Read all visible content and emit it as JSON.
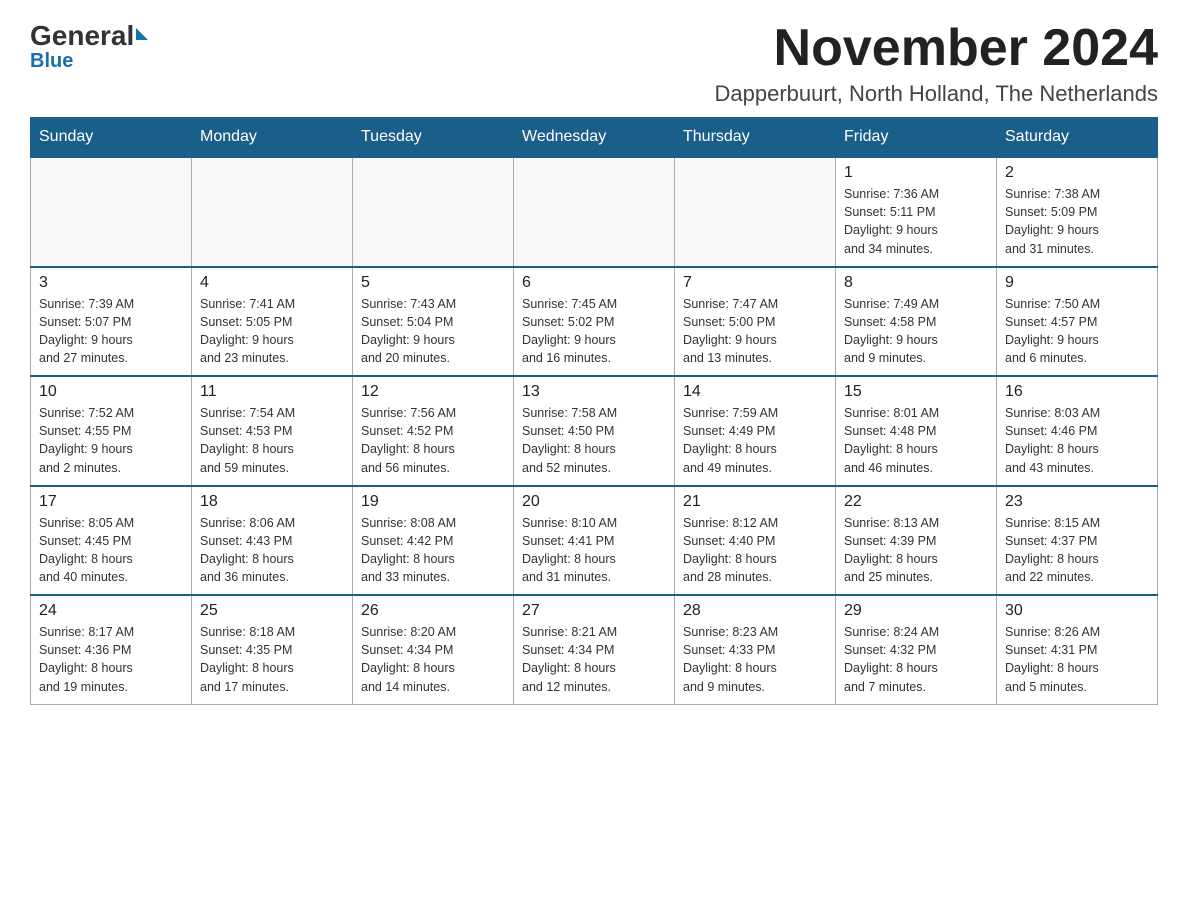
{
  "header": {
    "logo_general": "General",
    "logo_blue": "Blue",
    "month_year": "November 2024",
    "location": "Dapperbuurt, North Holland, The Netherlands"
  },
  "weekdays": [
    "Sunday",
    "Monday",
    "Tuesday",
    "Wednesday",
    "Thursday",
    "Friday",
    "Saturday"
  ],
  "weeks": [
    [
      {
        "day": "",
        "info": ""
      },
      {
        "day": "",
        "info": ""
      },
      {
        "day": "",
        "info": ""
      },
      {
        "day": "",
        "info": ""
      },
      {
        "day": "",
        "info": ""
      },
      {
        "day": "1",
        "info": "Sunrise: 7:36 AM\nSunset: 5:11 PM\nDaylight: 9 hours\nand 34 minutes."
      },
      {
        "day": "2",
        "info": "Sunrise: 7:38 AM\nSunset: 5:09 PM\nDaylight: 9 hours\nand 31 minutes."
      }
    ],
    [
      {
        "day": "3",
        "info": "Sunrise: 7:39 AM\nSunset: 5:07 PM\nDaylight: 9 hours\nand 27 minutes."
      },
      {
        "day": "4",
        "info": "Sunrise: 7:41 AM\nSunset: 5:05 PM\nDaylight: 9 hours\nand 23 minutes."
      },
      {
        "day": "5",
        "info": "Sunrise: 7:43 AM\nSunset: 5:04 PM\nDaylight: 9 hours\nand 20 minutes."
      },
      {
        "day": "6",
        "info": "Sunrise: 7:45 AM\nSunset: 5:02 PM\nDaylight: 9 hours\nand 16 minutes."
      },
      {
        "day": "7",
        "info": "Sunrise: 7:47 AM\nSunset: 5:00 PM\nDaylight: 9 hours\nand 13 minutes."
      },
      {
        "day": "8",
        "info": "Sunrise: 7:49 AM\nSunset: 4:58 PM\nDaylight: 9 hours\nand 9 minutes."
      },
      {
        "day": "9",
        "info": "Sunrise: 7:50 AM\nSunset: 4:57 PM\nDaylight: 9 hours\nand 6 minutes."
      }
    ],
    [
      {
        "day": "10",
        "info": "Sunrise: 7:52 AM\nSunset: 4:55 PM\nDaylight: 9 hours\nand 2 minutes."
      },
      {
        "day": "11",
        "info": "Sunrise: 7:54 AM\nSunset: 4:53 PM\nDaylight: 8 hours\nand 59 minutes."
      },
      {
        "day": "12",
        "info": "Sunrise: 7:56 AM\nSunset: 4:52 PM\nDaylight: 8 hours\nand 56 minutes."
      },
      {
        "day": "13",
        "info": "Sunrise: 7:58 AM\nSunset: 4:50 PM\nDaylight: 8 hours\nand 52 minutes."
      },
      {
        "day": "14",
        "info": "Sunrise: 7:59 AM\nSunset: 4:49 PM\nDaylight: 8 hours\nand 49 minutes."
      },
      {
        "day": "15",
        "info": "Sunrise: 8:01 AM\nSunset: 4:48 PM\nDaylight: 8 hours\nand 46 minutes."
      },
      {
        "day": "16",
        "info": "Sunrise: 8:03 AM\nSunset: 4:46 PM\nDaylight: 8 hours\nand 43 minutes."
      }
    ],
    [
      {
        "day": "17",
        "info": "Sunrise: 8:05 AM\nSunset: 4:45 PM\nDaylight: 8 hours\nand 40 minutes."
      },
      {
        "day": "18",
        "info": "Sunrise: 8:06 AM\nSunset: 4:43 PM\nDaylight: 8 hours\nand 36 minutes."
      },
      {
        "day": "19",
        "info": "Sunrise: 8:08 AM\nSunset: 4:42 PM\nDaylight: 8 hours\nand 33 minutes."
      },
      {
        "day": "20",
        "info": "Sunrise: 8:10 AM\nSunset: 4:41 PM\nDaylight: 8 hours\nand 31 minutes."
      },
      {
        "day": "21",
        "info": "Sunrise: 8:12 AM\nSunset: 4:40 PM\nDaylight: 8 hours\nand 28 minutes."
      },
      {
        "day": "22",
        "info": "Sunrise: 8:13 AM\nSunset: 4:39 PM\nDaylight: 8 hours\nand 25 minutes."
      },
      {
        "day": "23",
        "info": "Sunrise: 8:15 AM\nSunset: 4:37 PM\nDaylight: 8 hours\nand 22 minutes."
      }
    ],
    [
      {
        "day": "24",
        "info": "Sunrise: 8:17 AM\nSunset: 4:36 PM\nDaylight: 8 hours\nand 19 minutes."
      },
      {
        "day": "25",
        "info": "Sunrise: 8:18 AM\nSunset: 4:35 PM\nDaylight: 8 hours\nand 17 minutes."
      },
      {
        "day": "26",
        "info": "Sunrise: 8:20 AM\nSunset: 4:34 PM\nDaylight: 8 hours\nand 14 minutes."
      },
      {
        "day": "27",
        "info": "Sunrise: 8:21 AM\nSunset: 4:34 PM\nDaylight: 8 hours\nand 12 minutes."
      },
      {
        "day": "28",
        "info": "Sunrise: 8:23 AM\nSunset: 4:33 PM\nDaylight: 8 hours\nand 9 minutes."
      },
      {
        "day": "29",
        "info": "Sunrise: 8:24 AM\nSunset: 4:32 PM\nDaylight: 8 hours\nand 7 minutes."
      },
      {
        "day": "30",
        "info": "Sunrise: 8:26 AM\nSunset: 4:31 PM\nDaylight: 8 hours\nand 5 minutes."
      }
    ]
  ]
}
